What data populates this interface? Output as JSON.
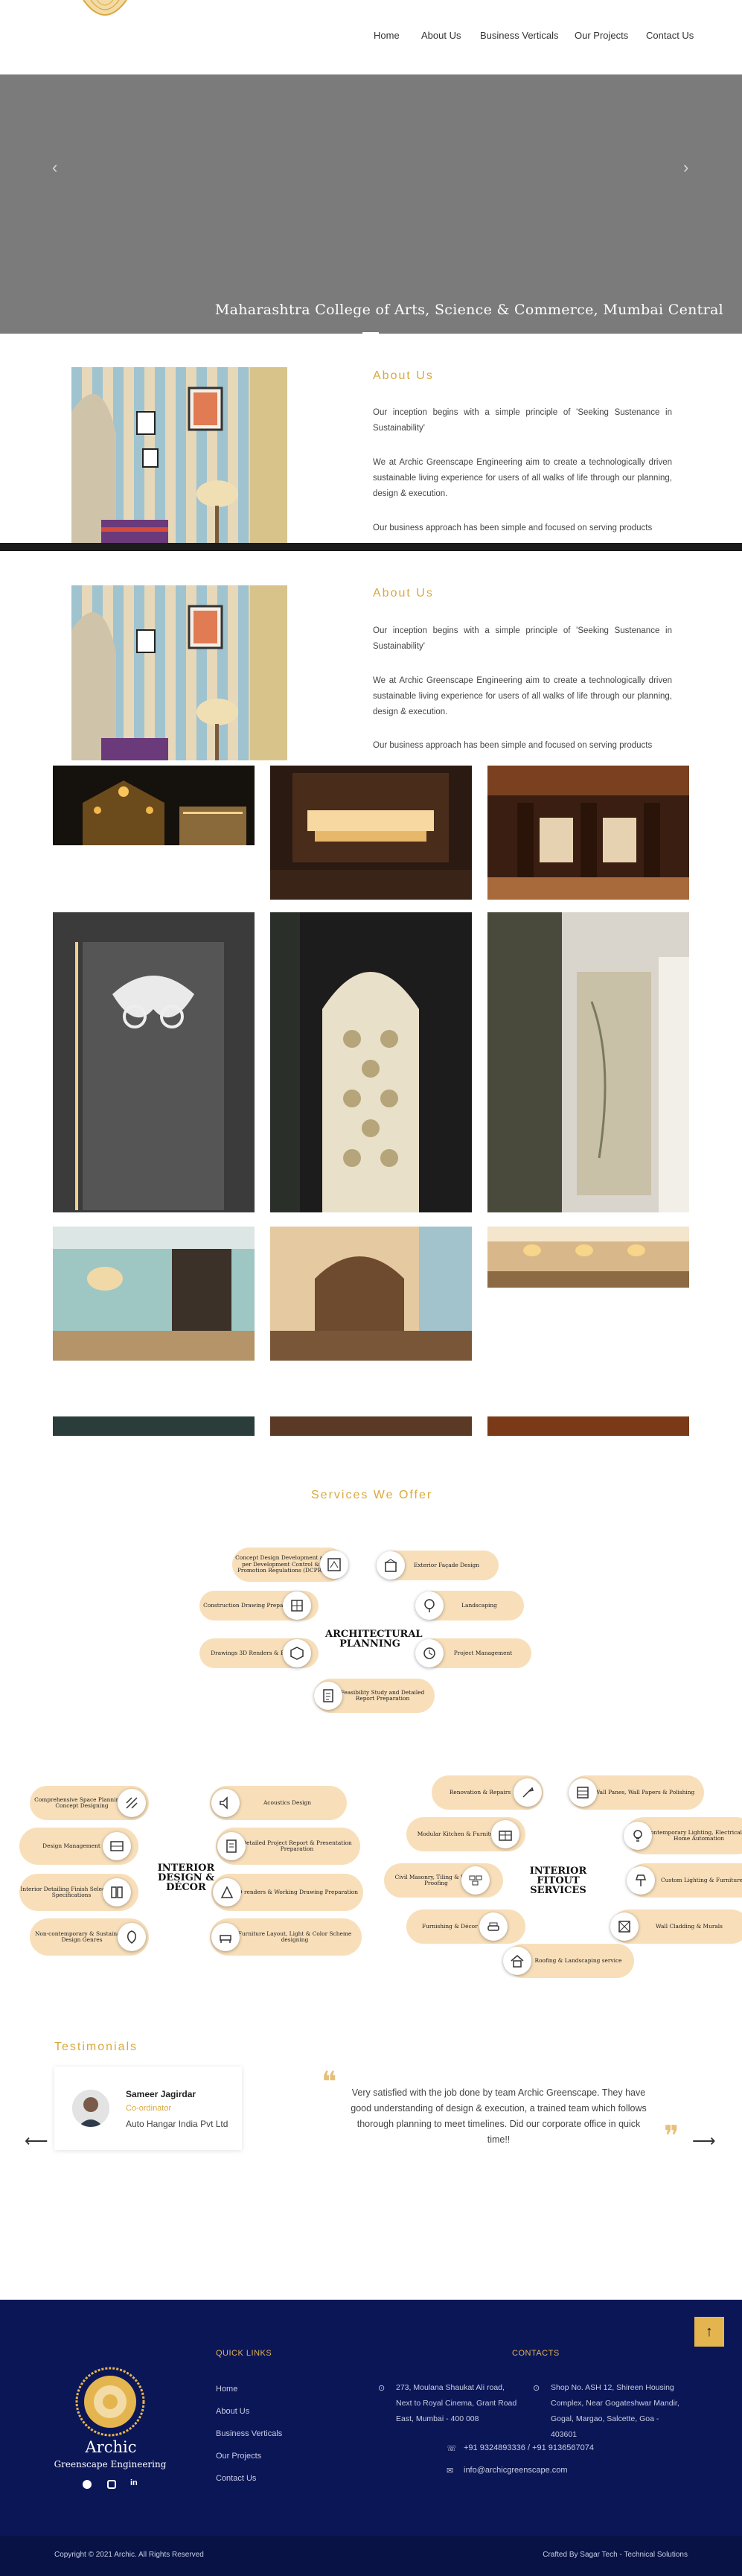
{
  "nav": {
    "items": [
      "Home",
      "About Us",
      "Business Verticals",
      "Our Projects",
      "Contact Us"
    ]
  },
  "hero": {
    "caption": "Maharashtra College of Arts, Science & Commerce, Mumbai Central",
    "prev": "‹",
    "next": "›"
  },
  "about": {
    "title": "About Us",
    "p1": "Our inception begins with a simple principle of 'Seeking Sustenance in Sustainability'",
    "p2": "We at Archic Greenscape Engineering aim to create a technologically driven sustainable living experience for users of all walks of life through our planning, design & execution.",
    "p3": "Our business approach has been simple and focused on serving products"
  },
  "services": {
    "title": "Services We Offer",
    "architectural": {
      "title": "ARCHITECTURAL PLANNING",
      "items": [
        "Concept Design Development as per Development Control & Promotion Regulations (DCPR)",
        "Exterior Façade Design",
        "Construction Drawing Preparation",
        "Landscaping",
        "Drawings 3D Renders & BIM",
        "Project Management",
        "Feasibility Study and Detailed Report Preparation"
      ]
    },
    "interior_design": {
      "title": "INTERIOR DESIGN & DÉCOR",
      "items": [
        "Comprehensive Space Planning & Concept Designing",
        "Acoustics Design",
        "Design Management",
        "Detailed Project Report & Presentation Preparation",
        "Interior Detailing Finish Selection & Specifications",
        "3D renders & Working Drawing Preparation",
        "Non-contemporary & Sustainable Design Genres",
        "Furniture Layout, Light & Color Scheme designing"
      ]
    },
    "interior_fitout": {
      "title": "INTERIOR FITOUT SERVICES",
      "items": [
        "Renovation & Repairs",
        "Wall Panes, Wall Papers & Polishing",
        "Modular Kitchen & Furniture",
        "Contemporary Lighting, Electricals & Home Automation",
        "Civil Masonry, Tiling & Water Proofing",
        "Custom Lighting & Furniture",
        "Furnishing & Décor Items",
        "Wall Cladding & Murals",
        "Roofing & Landscaping service"
      ]
    }
  },
  "testimonials": {
    "title": "Testimonials",
    "name": "Sameer Jagirdar",
    "role": "Co-ordinator",
    "company": "Auto Hangar India Pvt Ltd",
    "quote": "Very satisfied with the job done by team Archic Greenscape. They have good understanding of design & execution, a trained team which follows thorough planning to meet timelines. Did our corporate office in quick time!!",
    "open_quote": "❝",
    "close_quote": "❞",
    "prev": "⟵",
    "next": "⟶"
  },
  "footer": {
    "brand_name": "Archic",
    "brand_sub": "Greenscape Engineering",
    "quick_links_title": "QUICK LINKS",
    "quick_links": [
      "Home",
      "About Us",
      "Business Verticals",
      "Our Projects",
      "Contact Us"
    ],
    "contacts_title": "CONTACTS",
    "address1": "273, Moulana Shaukat Ali road, Next to Royal Cinema, Grant Road East, Mumbai - 400 008",
    "address2": "Shop No. ASH 12, Shireen Housing Complex, Near Gogateshwar Mandir, Gogal, Margao, Salcette, Goa - 403601",
    "phone": "+91 9324893336 / +91 9136567074",
    "email": "info@archicgreenscape.com",
    "copyright": "Copyright © 2021 Archic. All Rights Reserved",
    "credit": "Crafted By Sagar Tech - Technical Solutions",
    "scroll_top": "↑"
  },
  "colors": {
    "gold": "#d9a93f",
    "navy": "#0b1657",
    "pill": "#f8dfba",
    "hero_grey": "#7b7b7b"
  }
}
